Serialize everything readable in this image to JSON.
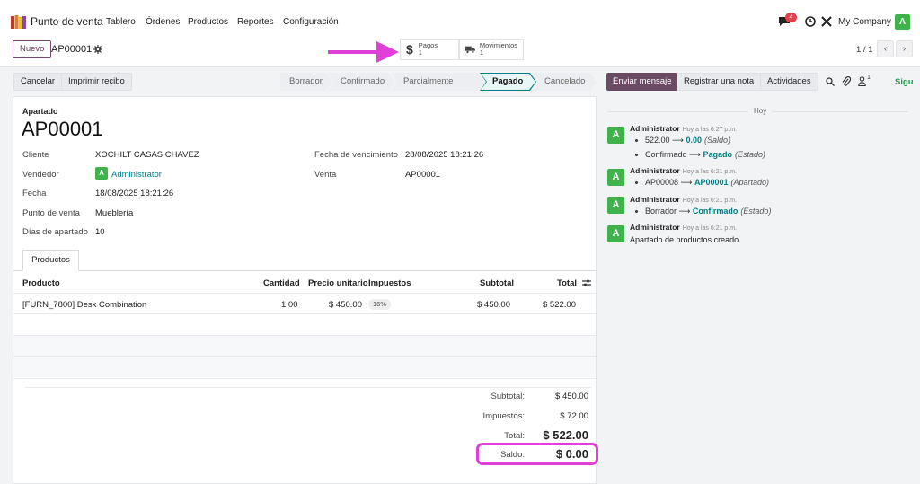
{
  "app": {
    "name": "Punto de venta",
    "icon": "pos-app-icon"
  },
  "menu": [
    "Tablero",
    "Órdenes",
    "Productos",
    "Reportes",
    "Configuración"
  ],
  "systray": {
    "chat_badge": "4",
    "company": "My Company",
    "user_initial": "A"
  },
  "control": {
    "new_label": "Nuevo",
    "record": "AP00001",
    "smart_buttons": [
      {
        "label": "Pagos",
        "count": "1",
        "icon": "dollar-icon"
      },
      {
        "label": "Movimientos",
        "count": "1",
        "icon": "truck-icon"
      }
    ],
    "pager": "1 / 1"
  },
  "actions": {
    "cancel": "Cancelar",
    "print": "Imprimir recibo"
  },
  "statusbar": [
    "Borrador",
    "Confirmado",
    "Parcialmente Pagado",
    "Pagado",
    "Cancelado"
  ],
  "statusbar_active": "Pagado",
  "form": {
    "small_title": "Apartado",
    "title": "AP00001",
    "cliente_label": "Cliente",
    "cliente": "XOCHILT CASAS CHAVEZ",
    "vendedor_label": "Vendedor",
    "vendedor": "Administrator",
    "vendedor_initial": "A",
    "fecha_label": "Fecha",
    "fecha": "18/08/2025 18:21:26",
    "pv_label": "Punto de venta",
    "pv": "Mueblería",
    "dias_label": "Días de apartado",
    "dias": "10",
    "venc_label": "Fecha de vencimiento",
    "venc": "28/08/2025 18:21:26",
    "venta_label": "Venta",
    "venta": "AP00001"
  },
  "tab": "Productos",
  "table": {
    "headers": [
      "Producto",
      "Cantidad",
      "Precio unitario",
      "Impuestos",
      "Subtotal",
      "Total"
    ],
    "rows": [
      {
        "producto": "[FURN_7800] Desk Combination",
        "cantidad": "1.00",
        "precio": "$ 450.00",
        "impuestos": "16%",
        "subtotal": "$ 450.00",
        "total": "$ 522.00"
      }
    ]
  },
  "totals": {
    "subtotal_label": "Subtotal:",
    "subtotal": "$ 450.00",
    "impuestos_label": "Impuestos:",
    "impuestos": "$ 72.00",
    "total_label": "Total:",
    "total": "$ 522.00",
    "saldo_label": "Saldo:",
    "saldo": "$ 0.00"
  },
  "chatter": {
    "send": "Enviar mensaje",
    "note": "Registrar una nota",
    "activities": "Actividades",
    "followers_count": "1",
    "follow": "Sigu",
    "day": "Hoy",
    "messages": [
      {
        "author": "Administrator",
        "time": "Hoy a las 6:27 p.m.",
        "changes": [
          {
            "old": "522.00",
            "new": "0.00",
            "field": "(Saldo)"
          },
          {
            "old": "Confirmado",
            "new": "Pagado",
            "field": "(Estado)"
          }
        ]
      },
      {
        "author": "Administrator",
        "time": "Hoy a las 6:21 p.m.",
        "changes": [
          {
            "old": "AP00008",
            "new": "AP00001",
            "field": "(Apartado)"
          }
        ]
      },
      {
        "author": "Administrator",
        "time": "Hoy a las 6:21 p.m.",
        "changes": [
          {
            "old": "Borrador",
            "new": "Confirmado",
            "field": "(Estado)"
          }
        ]
      },
      {
        "author": "Administrator",
        "time": "Hoy a las 6:21 p.m.",
        "body": "Apartado de productos creado"
      }
    ]
  },
  "colors": {
    "brand": "#6b4a64",
    "accent_link": "#017e84",
    "avatar": "#3eb34a",
    "annotation": "#e040d8"
  }
}
